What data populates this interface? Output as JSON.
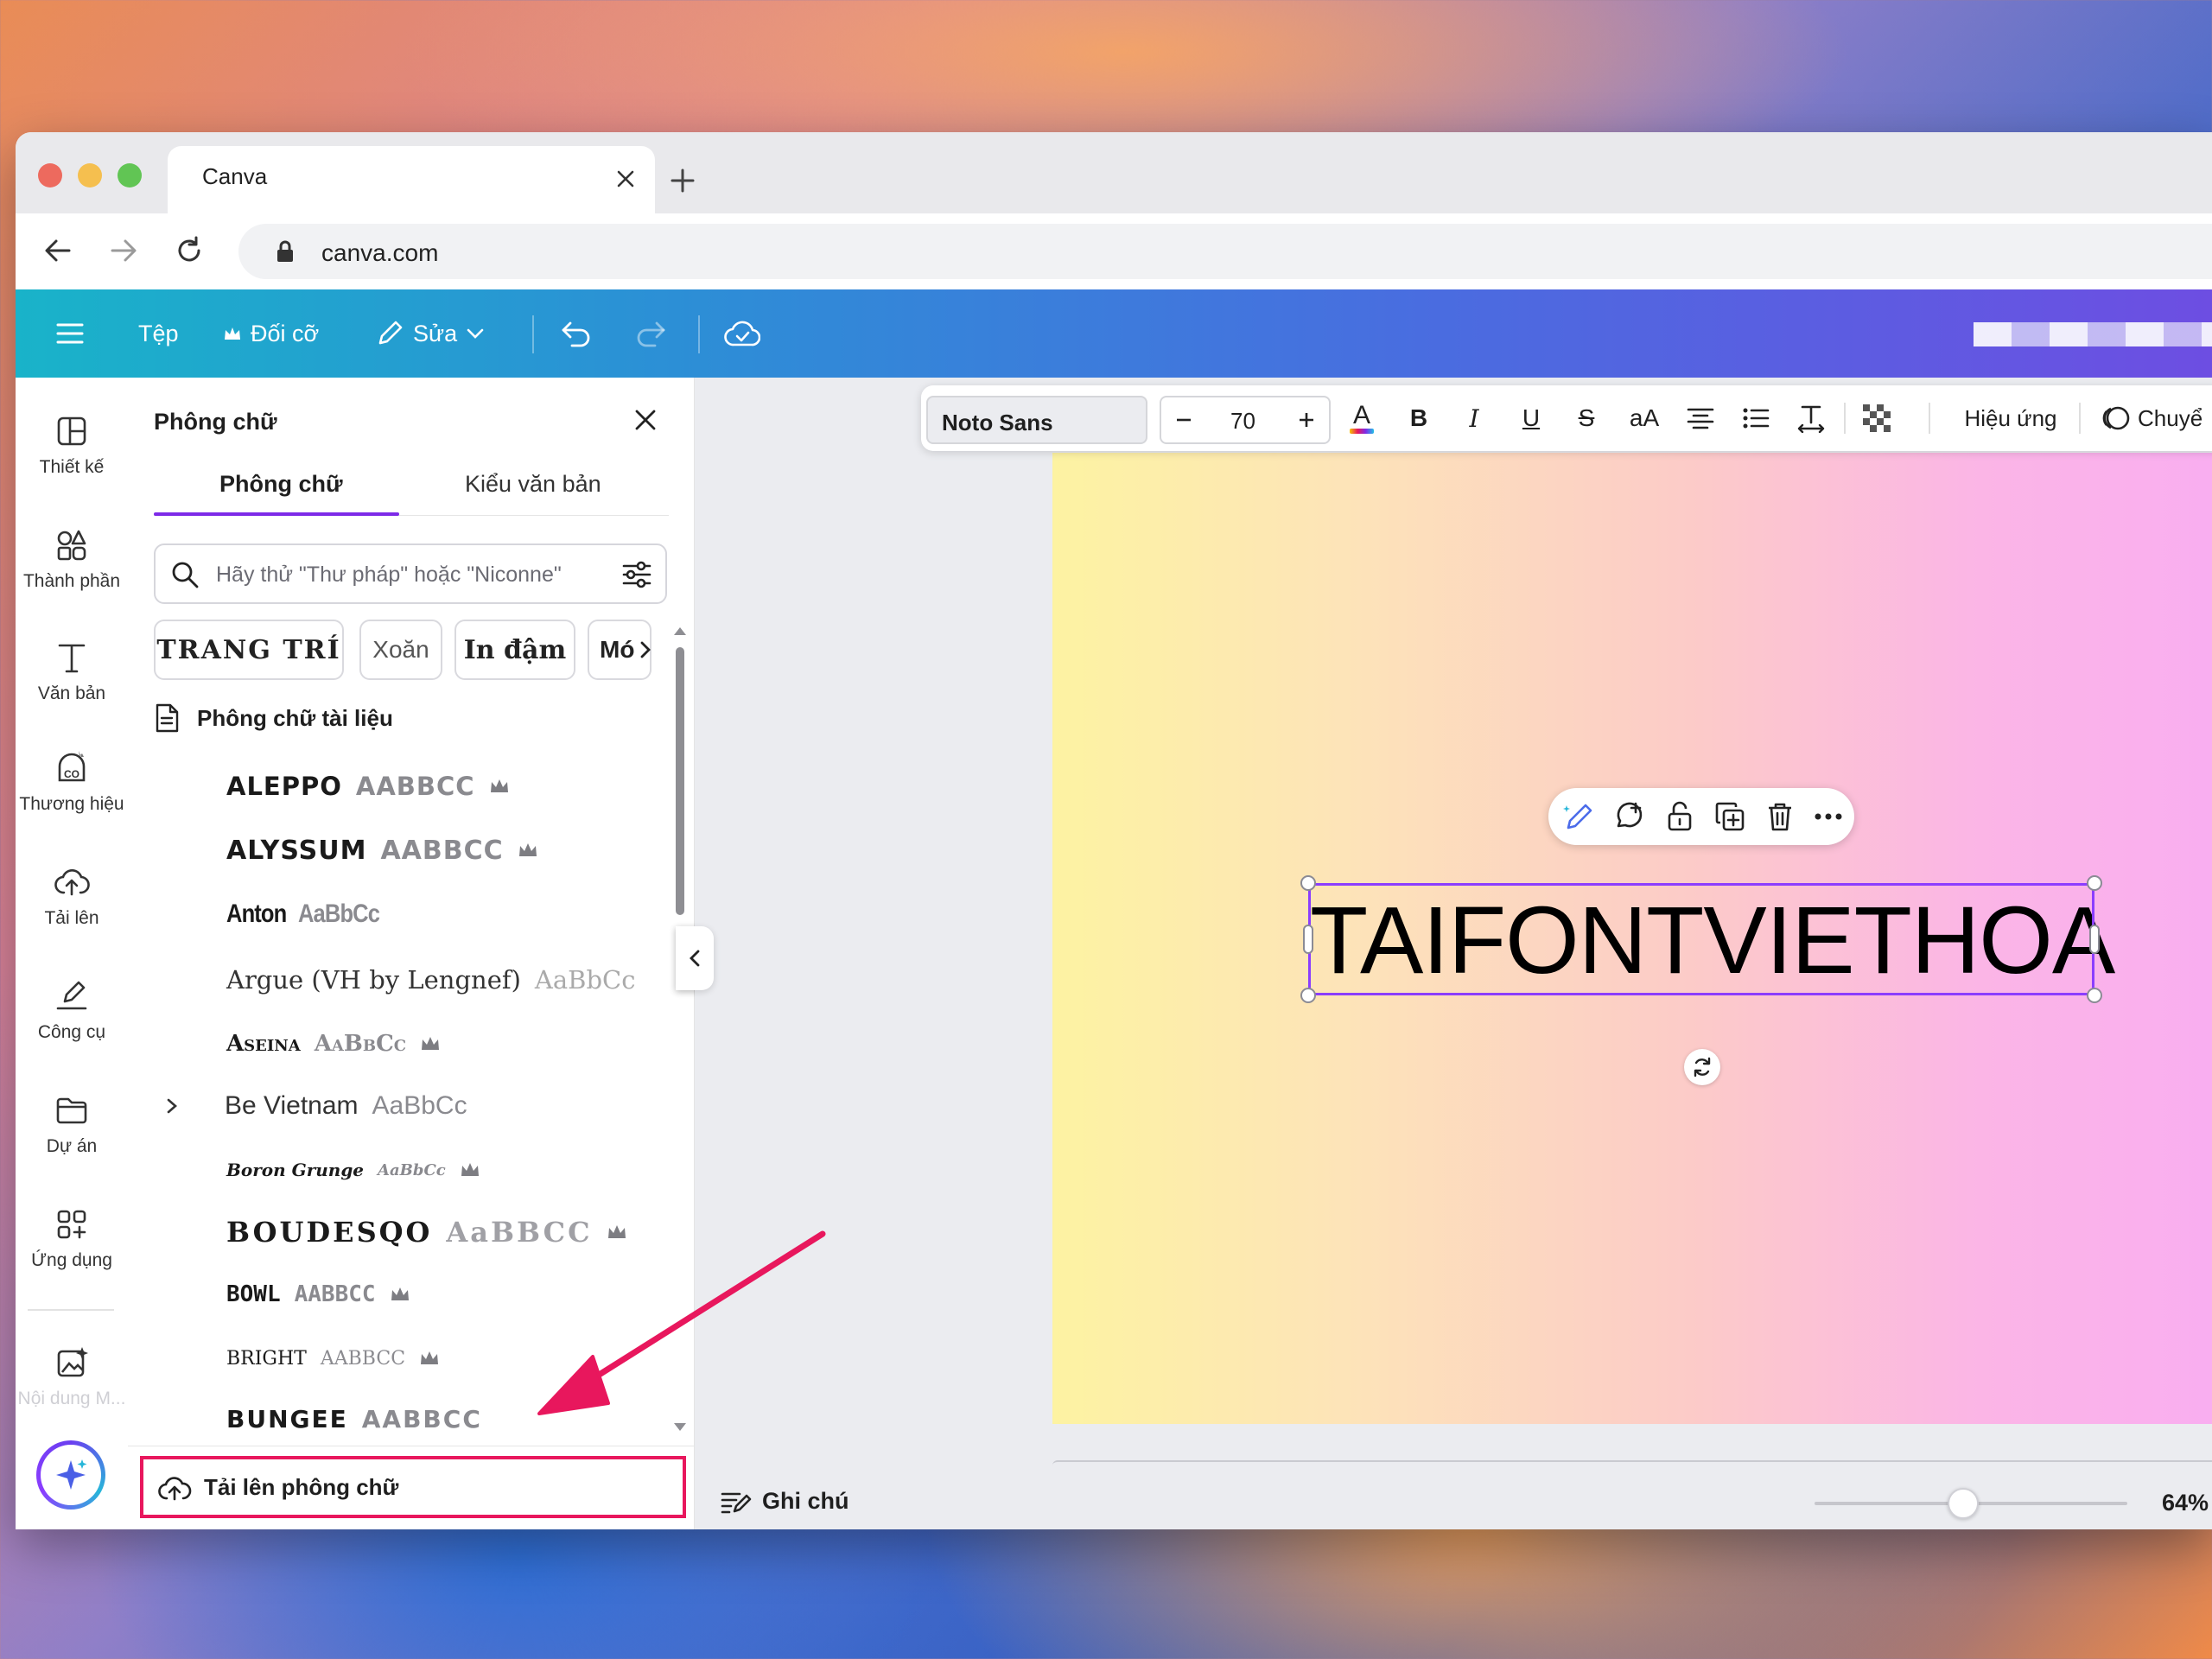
{
  "browser": {
    "tab_title": "Canva",
    "url": "canva.com"
  },
  "header": {
    "file_label": "Tệp",
    "resize_label": "Đối cỡ",
    "edit_label": "Sửa"
  },
  "rail": {
    "items": [
      {
        "label": "Thiết kế",
        "icon": "layout-icon"
      },
      {
        "label": "Thành phần",
        "icon": "elements-icon"
      },
      {
        "label": "Văn bản",
        "icon": "text-icon"
      },
      {
        "label": "Thương hiệu",
        "icon": "brand-icon"
      },
      {
        "label": "Tải lên",
        "icon": "upload-icon"
      },
      {
        "label": "Công cụ",
        "icon": "draw-icon"
      },
      {
        "label": "Dự án",
        "icon": "folder-icon"
      },
      {
        "label": "Ứng dụng",
        "icon": "apps-icon"
      },
      {
        "label": "Nội dung M...",
        "icon": "magic-media-icon"
      }
    ]
  },
  "panel": {
    "title": "Phông chữ",
    "tabs": [
      "Phông chữ",
      "Kiểu văn bản"
    ],
    "search_placeholder": "Hãy thử \"Thư pháp\" hoặc \"Niconne\"",
    "chips": [
      "TRANG TRÍ",
      "Xoăn",
      "In đậm",
      "Mó"
    ],
    "section_title": "Phông chữ tài liệu",
    "fonts": [
      {
        "name": "ALEPPO",
        "sample": "AABBCC",
        "premium": true
      },
      {
        "name": "ALYSSUM",
        "sample": "AABBCC",
        "premium": true
      },
      {
        "name": "Anton",
        "sample": "AaBbCc",
        "premium": false
      },
      {
        "name": "Argue (VH by Lengnef)",
        "sample": "AaBbCc",
        "premium": false
      },
      {
        "name": "Aseina",
        "sample": "AaBbCc",
        "premium": true
      },
      {
        "name": "Be Vietnam",
        "sample": "AaBbCc",
        "premium": false
      },
      {
        "name": "Boron Grunge",
        "sample": "AaBbCc",
        "premium": true
      },
      {
        "name": "BOUDESQO",
        "sample": "AaBBCC",
        "premium": true
      },
      {
        "name": "BOWL",
        "sample": "AABBCC",
        "premium": true
      },
      {
        "name": "BRIGHT",
        "sample": "AABBCC",
        "premium": true
      },
      {
        "name": "BUNGEE",
        "sample": "AABBCC",
        "premium": false
      }
    ],
    "upload_label": "Tải lên phông chữ"
  },
  "toolbar": {
    "font": "Noto Sans",
    "size": "70",
    "effects_label": "Hiệu ứng",
    "animate_label": "Chuyể"
  },
  "canvas": {
    "text": "TAIFONTVIETHOA"
  },
  "footer": {
    "notes_label": "Ghi chú",
    "zoom": "64%",
    "zoom_level": 0.64
  },
  "colors": {
    "accent": "#7d2ae8",
    "highlight": "#e8175d"
  }
}
